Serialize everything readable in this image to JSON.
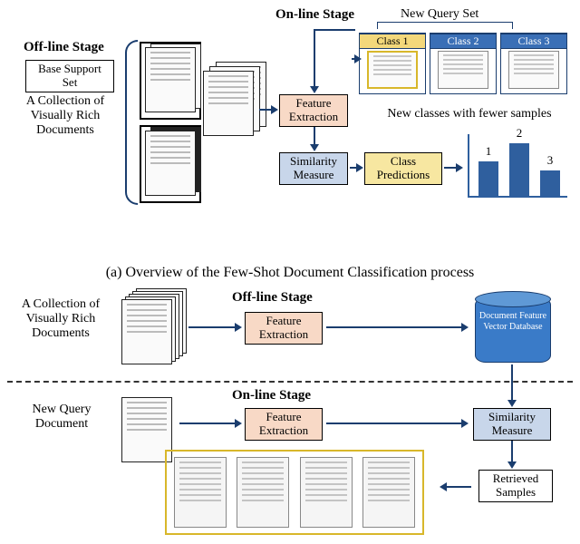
{
  "panel_a": {
    "online_title": "On-line Stage",
    "offline_title": "Off-line Stage",
    "new_query_set": "New Query Set",
    "base_support_set": "Base Support Set",
    "collection_label": "A Collection of Visually Rich Documents",
    "feature_extraction": "Feature Extraction",
    "similarity_measure": "Similarity Measure",
    "class_predictions": "Class Predictions",
    "fewer_samples": "New classes with fewer samples",
    "query_classes": [
      "Class 1",
      "Class 2",
      "Class 3"
    ],
    "bar_labels": [
      "1",
      "2",
      "3"
    ]
  },
  "caption": "(a) Overview of the Few-Shot Document Classification process",
  "panel_b": {
    "offline_title": "Off-line Stage",
    "online_title": "On-line Stage",
    "collection_label": "A Collection of Visually Rich Documents",
    "feature_extraction": "Feature Extraction",
    "db_label": "Document Feature Vector Database",
    "new_query_doc": "New Query Document",
    "similarity_measure": "Similarity Measure",
    "retrieved_samples": "Retrieved Samples"
  },
  "chart_data": {
    "type": "bar",
    "categories": [
      "1",
      "2",
      "3"
    ],
    "values": [
      40,
      62,
      30
    ],
    "title": "",
    "xlabel": "",
    "ylabel": "",
    "ylim": [
      0,
      70
    ]
  }
}
